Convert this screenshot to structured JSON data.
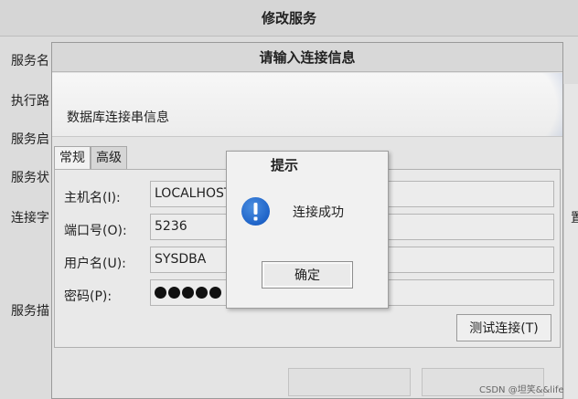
{
  "outer_dialog": {
    "title": "修改服务",
    "labels": [
      "服务名",
      "执行路",
      "服务启",
      "服务状",
      "连接字",
      "服务描"
    ],
    "right_edge_char": "置"
  },
  "inner_dialog": {
    "title": "请输入连接信息",
    "banner_text": "数据库连接串信息",
    "tabs": [
      {
        "label": "常规",
        "active": true
      },
      {
        "label": "高级",
        "active": false
      }
    ],
    "fields": {
      "host": {
        "label": "主机名(I):",
        "value": "LOCALHOST"
      },
      "port": {
        "label": "端口号(O):",
        "value": "5236"
      },
      "user": {
        "label": "用户名(U):",
        "value": "SYSDBA"
      },
      "password": {
        "label": "密码(P):",
        "masked_count": 5
      }
    },
    "test_button": "测试连接(T)"
  },
  "alert": {
    "title": "提示",
    "icon": "info-icon",
    "message": "连接成功",
    "ok_button": "确定"
  },
  "watermark": "CSDN @坦笑&&life"
}
